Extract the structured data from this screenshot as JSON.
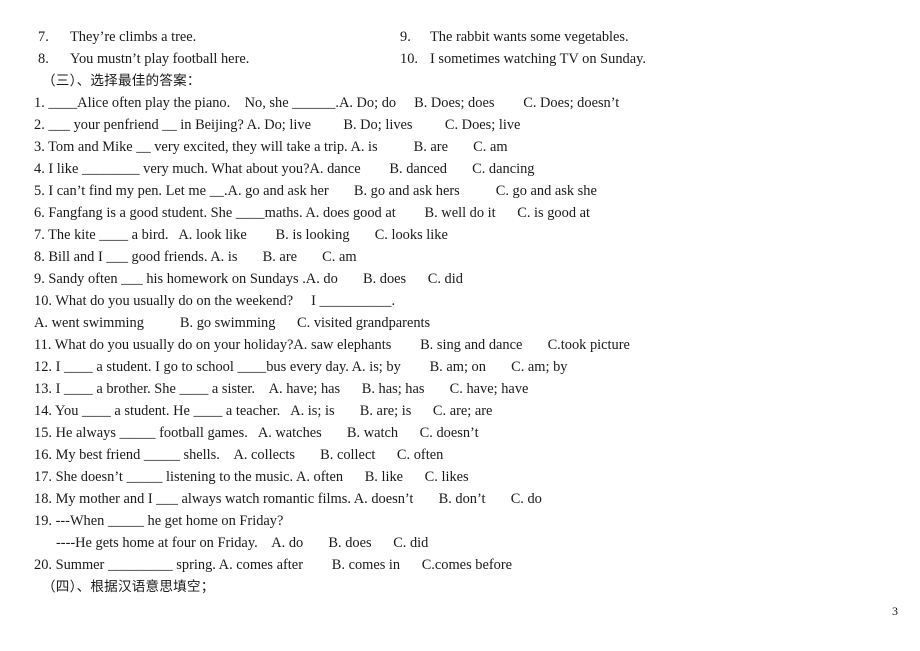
{
  "document": {
    "page_number": "3",
    "top_sentences": {
      "left": [
        {
          "num": "7.",
          "text": "They’re climbs a tree."
        },
        {
          "num": "8.",
          "text": "You mustn’t play football here."
        }
      ],
      "right": [
        {
          "num": "9.",
          "text": "The rabbit wants some vegetables."
        },
        {
          "num": "10.",
          "text": "I sometimes watching TV on Sunday."
        }
      ]
    },
    "section_three_heading": "（三）、选择最佳的答案：",
    "questions": [
      "1. ____Alice often play the piano.    No, she ______.A. Do; do     B. Does; does        C. Does; doesn’t",
      "2. ___ your penfriend __ in Beijing? A. Do; live         B. Do; lives         C. Does; live",
      "3. Tom and Mike __ very excited, they will take a trip. A. is          B. are       C. am",
      "4. I like ________ very much. What about you?A. dance        B. danced       C. dancing",
      "5. I can’t find my pen. Let me __.A. go and ask her       B. go and ask hers          C. go and ask she",
      "6. Fangfang is a good student. She ____maths. A. does good at        B. well do it      C. is good at",
      "7. The kite ____ a bird.   A. look like        B. is looking       C. looks like",
      "8. Bill and I ___ good friends. A. is       B. are       C. am",
      "9. Sandy often ___ his homework on Sundays .A. do       B. does      C. did",
      "10. What do you usually do on the weekend?     I __________.",
      "A. went swimming          B. go swimming      C. visited grandparents",
      "11. What do you usually do on your holiday?A. saw elephants        B. sing and dance       C.took picture",
      "12. I ____ a student. I go to school ____bus every day. A. is; by        B. am; on       C. am; by",
      "13. I ____ a brother. She ____ a sister.    A. have; has      B. has; has       C. have; have",
      "14. You ____ a student. He ____ a teacher.   A. is; is       B. are; is      C. are; are",
      "15. He always _____ football games.   A. watches       B. watch      C. doesn’t",
      "16. My best friend _____ shells.    A. collects       B. collect      C. often",
      "17. She doesn’t _____ listening to the music. A. often      B. like      C. likes",
      "18. My mother and I ___ always watch romantic films. A. doesn’t       B. don’t       C. do",
      "19. ---When _____ he get home on Friday?"
    ],
    "question_19_answer_line": "----He gets home at four on Friday.    A. do       B. does      C. did",
    "question_20": "20. Summer _________ spring. A. comes after        B. comes in      C.comes before",
    "section_four_heading": "（四）、根据汉语意思填空；"
  }
}
